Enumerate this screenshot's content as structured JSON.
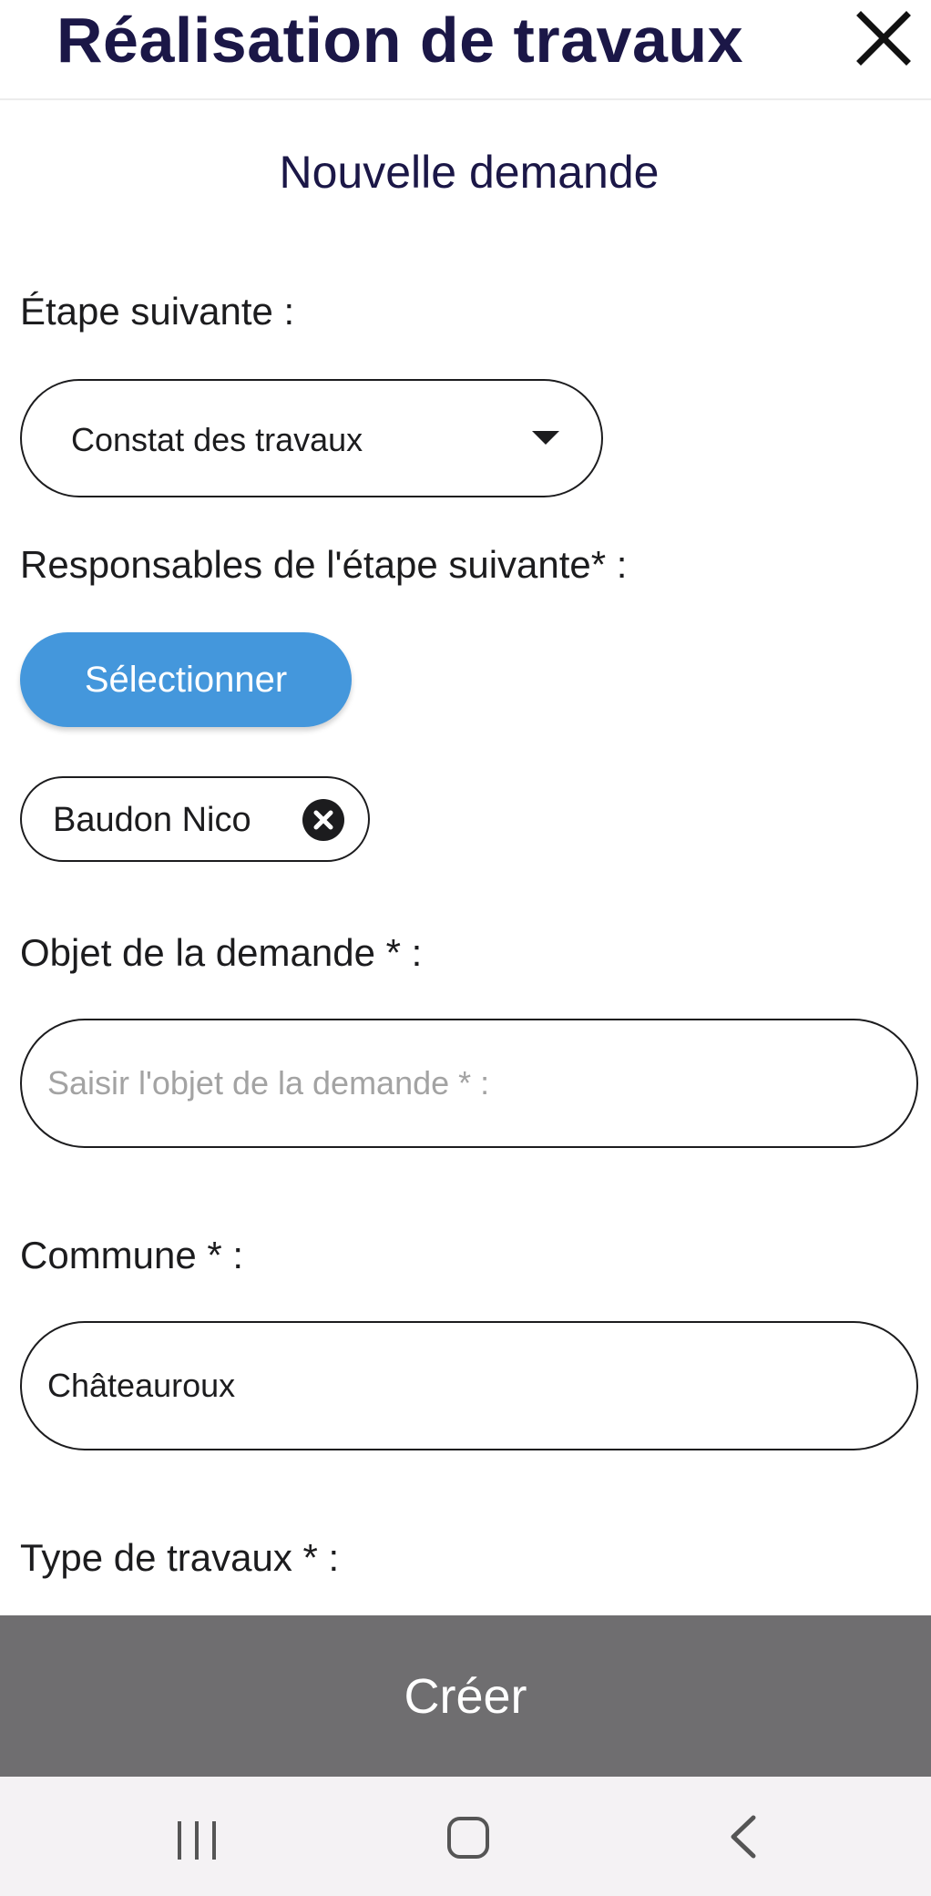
{
  "header": {
    "title": "Réalisation de travaux"
  },
  "form": {
    "subtitle": "Nouvelle demande",
    "next_step": {
      "label": "Étape suivante :",
      "selected": "Constat des travaux"
    },
    "responsables": {
      "label": "Responsables de l'étape suivante* :",
      "button_label": "Sélectionner",
      "chips": [
        {
          "label": "Baudon Nico"
        }
      ]
    },
    "objet": {
      "label": "Objet de la demande * :",
      "value": "",
      "placeholder": "Saisir l'objet de la demande * :"
    },
    "commune": {
      "label": "Commune * :",
      "value": "Châteauroux"
    },
    "type_travaux": {
      "label": "Type de travaux * :"
    }
  },
  "footer": {
    "create_label": "Créer"
  },
  "colors": {
    "title": "#1b1747",
    "accent_button": "#4497dc",
    "create_bar": "#6f6e70"
  },
  "icons": {
    "close": "close-icon",
    "dropdown": "caret-down-icon",
    "chip_remove": "close-circle-icon",
    "nav_recent": "recent-apps-icon",
    "nav_home": "home-icon",
    "nav_back": "back-icon"
  }
}
